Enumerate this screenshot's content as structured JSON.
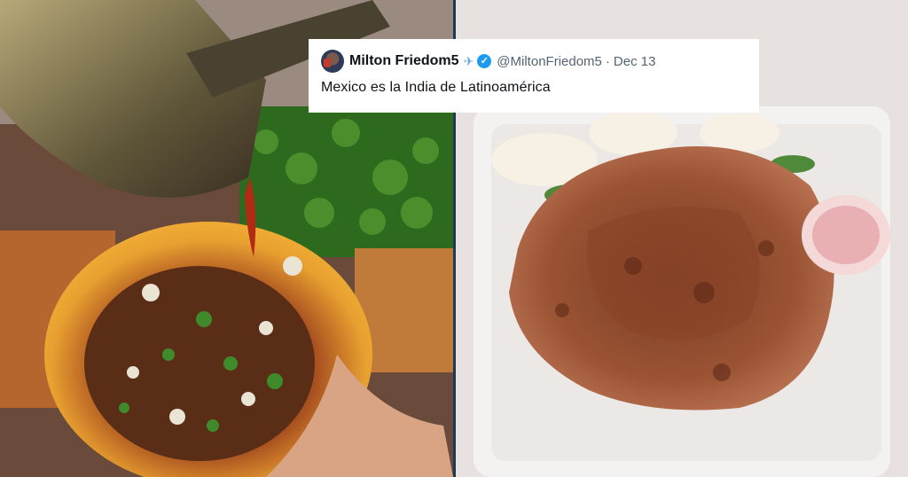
{
  "tweet": {
    "display_name": "Milton Friedom5",
    "handle": "@MiltonFriedom5",
    "separator": "·",
    "date": "Dec 13",
    "text": "Mexico es la India de Latinoamérica",
    "icons": [
      "avatar",
      "airplane-icon",
      "verified-badge-icon"
    ]
  },
  "colors": {
    "verified": "#1d9bf0",
    "divider": "#1e3a52",
    "card_background": "#ffffff"
  }
}
